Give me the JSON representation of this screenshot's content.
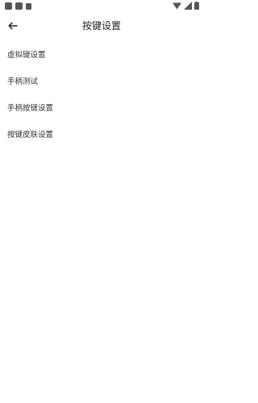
{
  "toolbar": {
    "title": "按键设置"
  },
  "menu": {
    "items": [
      {
        "label": "虚拟键设置"
      },
      {
        "label": "手柄测试"
      },
      {
        "label": "手柄按键设置"
      },
      {
        "label": "按键皮肤设置"
      }
    ]
  },
  "icons": {
    "back": "arrow-left-icon",
    "wifi": "wifi-icon",
    "signal": "cellular-signal-icon",
    "battery": "battery-icon"
  }
}
